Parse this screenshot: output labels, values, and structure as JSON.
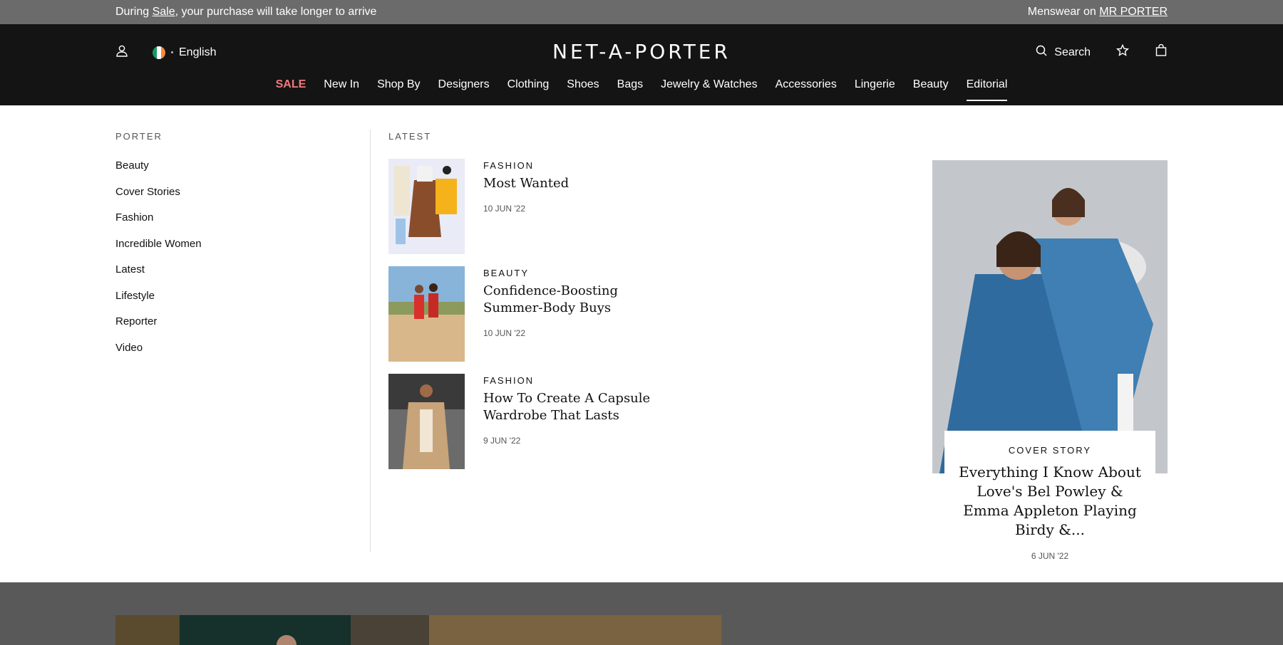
{
  "topbar": {
    "left_prefix": "During ",
    "left_link": "Sale",
    "left_suffix": ", your purchase will take longer to arrive",
    "right_prefix": "Menswear on ",
    "right_link": "MR PORTER"
  },
  "header": {
    "language": "English",
    "logo": "NET-A-PORTER",
    "search_label": "Search"
  },
  "nav": [
    "SALE",
    "New In",
    "Shop By",
    "Designers",
    "Clothing",
    "Shoes",
    "Bags",
    "Jewelry & Watches",
    "Accessories",
    "Lingerie",
    "Beauty",
    "Editorial"
  ],
  "porter": {
    "heading": "PORTER",
    "items": [
      "Beauty",
      "Cover Stories",
      "Fashion",
      "Incredible Women",
      "Latest",
      "Lifestyle",
      "Reporter",
      "Video"
    ]
  },
  "latest": {
    "heading": "LATEST",
    "articles": [
      {
        "category": "FASHION",
        "title": "Most Wanted",
        "date": "10 JUN '22"
      },
      {
        "category": "BEAUTY",
        "title": "Confidence-Boosting Summer-Body Buys",
        "date": "10 JUN '22"
      },
      {
        "category": "FASHION",
        "title": "How To Create A Capsule Wardrobe That Lasts",
        "date": "9 JUN '22"
      }
    ]
  },
  "featured": {
    "category": "COVER STORY",
    "title": "Everything I Know About Love's Bel Powley & Emma Appleton Playing Birdy &...",
    "date": "6 JUN '22"
  },
  "colors": {
    "topbar_bg": "#6b6b6b",
    "header_bg": "#141414",
    "sale_accent": "#f07a7a"
  }
}
